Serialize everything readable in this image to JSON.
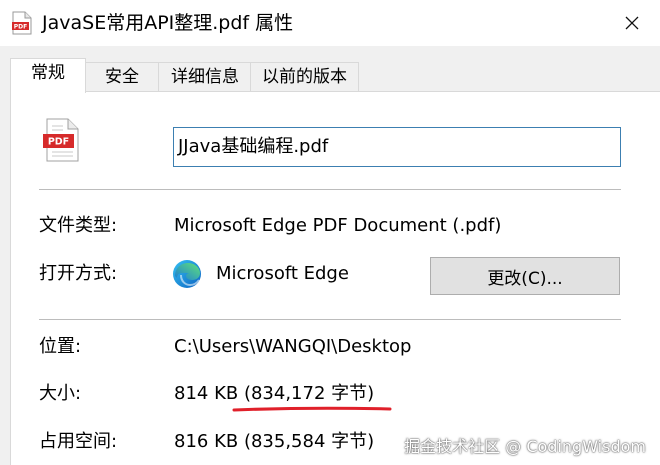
{
  "window": {
    "title": "JavaSE常用API整理.pdf 属性"
  },
  "tabs": [
    {
      "label": "常规",
      "active": true
    },
    {
      "label": "安全",
      "active": false
    },
    {
      "label": "详细信息",
      "active": false
    },
    {
      "label": "以前的版本",
      "active": false
    }
  ],
  "general": {
    "file_icon_label": "PDF",
    "file_name": "JJava基础编程.pdf",
    "file_type_label": "文件类型:",
    "file_type_value": "Microsoft Edge PDF Document (.pdf)",
    "opens_with_label": "打开方式:",
    "opens_with_value": "Microsoft Edge",
    "change_button": "更改(C)...",
    "location_label": "位置:",
    "location_value": "C:\\Users\\WANGQI\\Desktop",
    "size_label": "大小:",
    "size_value": "814 KB (834,172 字节)",
    "size_on_disk_label": "占用空间:",
    "size_on_disk_value": "816 KB (835,584 字节)"
  },
  "watermark": "掘金技术社区 @ CodingWisdom",
  "colors": {
    "accent_border": "#3c7fb1",
    "pdf_red": "#d62a2a",
    "annotation_red": "#e0202a"
  },
  "icons": {
    "title": "pdf-file-icon",
    "close": "close-icon",
    "file": "pdf-file-icon",
    "app": "microsoft-edge-icon"
  }
}
